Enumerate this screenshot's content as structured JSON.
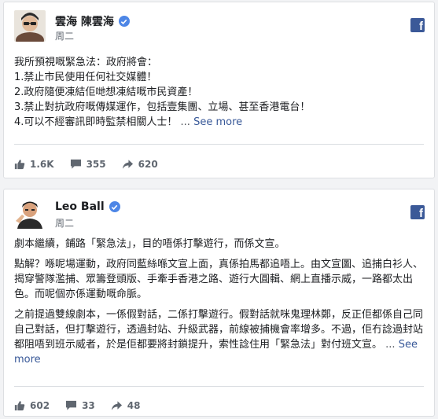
{
  "posts": [
    {
      "author": "雲海 陳雲海",
      "time": "周二",
      "lines": [
        "我所預視嘅緊急法：政府將會：",
        "1.禁止市民使用任何社交媒體！",
        "2.政府隨便凍結佢哋想凍結嘅市民資產！",
        "3.禁止對抗政府嘅傳媒運作，包括壹集團、立場、甚至香港電台！"
      ],
      "last_line": "4.可以不經審訊即時監禁相關人士！",
      "ellipsis": "...",
      "see_more": "See more",
      "likes": "1.6K",
      "comments": "355",
      "shares": "620"
    },
    {
      "author": "Leo Ball",
      "time": "周二",
      "paragraphs": [
        "劇本繼續，鋪路「緊急法」，目的唔係打擊遊行，而係文宣。",
        "點解？喺呢場運動，政府同藍絲喺文宣上面，真係拍馬都追唔上。由文宣圖、追捕白衫人、揭穿警隊濫捕、眾籌登頭版、手牽手香港之路、遊行大圓輯、網上直播示威，一路都太出色。而呢個亦係運動嘅命脈。"
      ],
      "last_paragraph": "之前提過雙線劇本，一係假對話，二係打擊遊行。假對話就咪鬼理林鄭，反正佢都係自己同自己對話，但打擊遊行，透過封站、升級武器，前線被捕機會率增多。不過，佢冇諗過封站都阻唔到班示威者，於是佢都要將封鎖提升，索性諗住用「緊急法」對付班文宣。",
      "ellipsis": "...",
      "see_more": "See more",
      "likes": "602",
      "comments": "33",
      "shares": "48"
    }
  ],
  "colors": {
    "facebook_blue": "#3b5998",
    "link_blue": "#385898",
    "verified_blue": "#4d86e6",
    "meta_grey": "#606770"
  }
}
